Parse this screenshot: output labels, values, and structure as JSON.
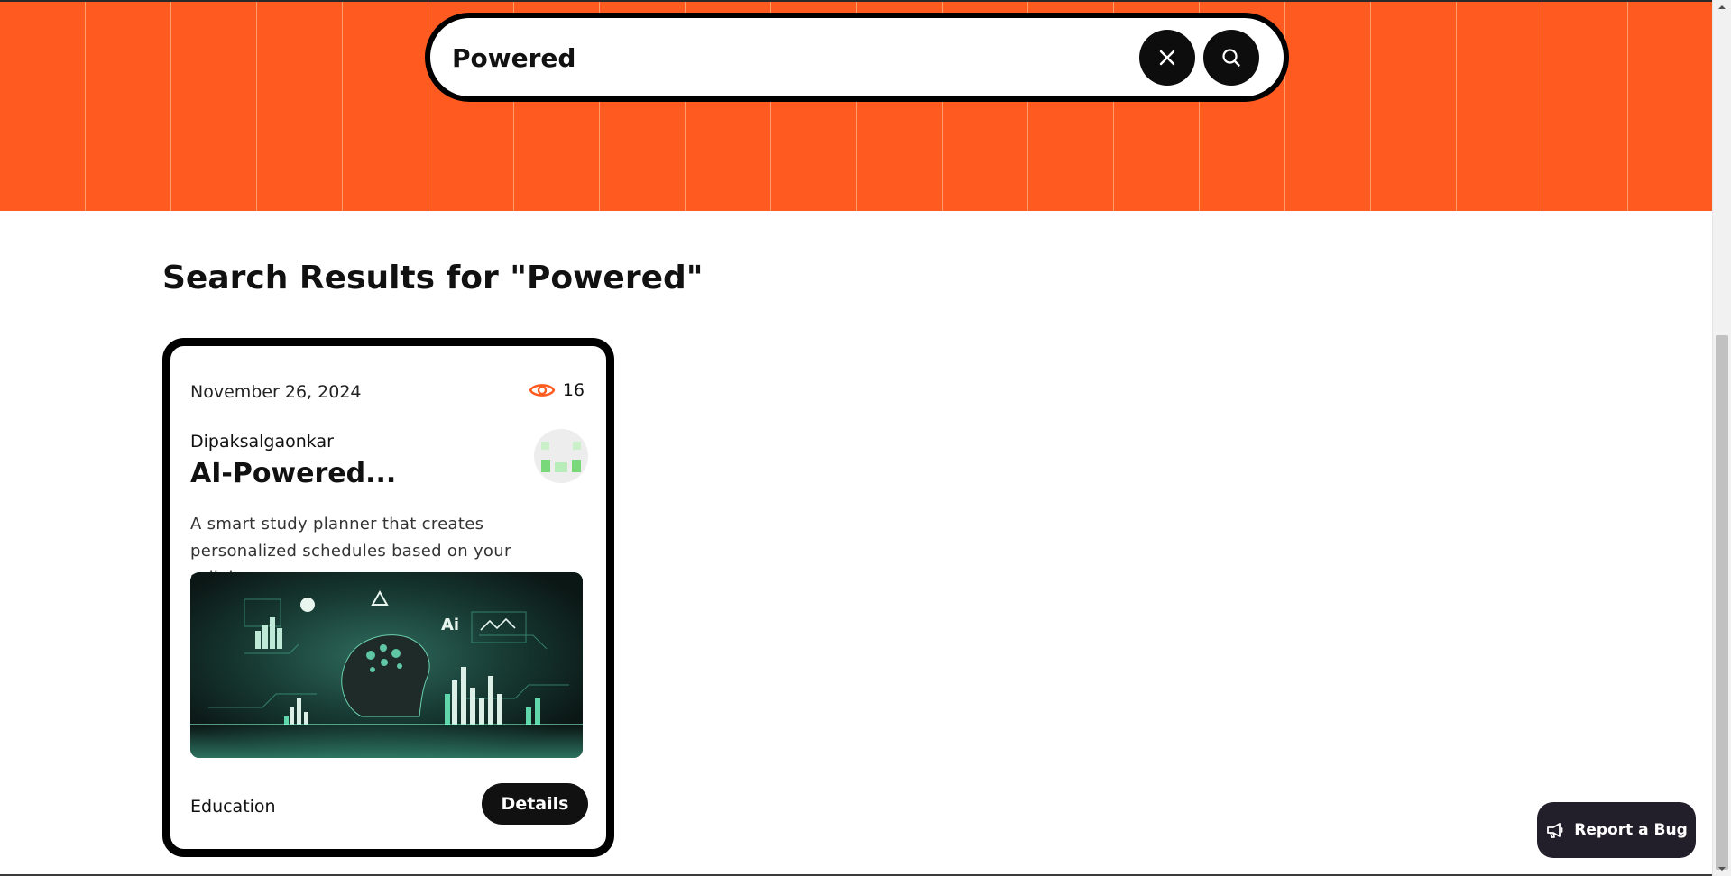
{
  "search": {
    "value": "Powered",
    "clear_icon": "close-icon",
    "submit_icon": "search-icon"
  },
  "results": {
    "heading": "Search Results for \"Powered\""
  },
  "card": {
    "date": "November 26, 2024",
    "views": "16",
    "views_icon": "eye-icon",
    "author": "Dipaksalgaonkar",
    "title": "AI-Powered...",
    "description": "A smart study planner that creates personalized schedules based on your syllabus, ex...",
    "category": "Education",
    "details_label": "Details"
  },
  "report": {
    "label": "Report a Bug",
    "icon": "megaphone-icon"
  },
  "colors": {
    "hero_orange": "#ff5a1f",
    "accent_orange": "#ff5a1f",
    "dark": "#111111",
    "report_bg": "#221f2a"
  }
}
